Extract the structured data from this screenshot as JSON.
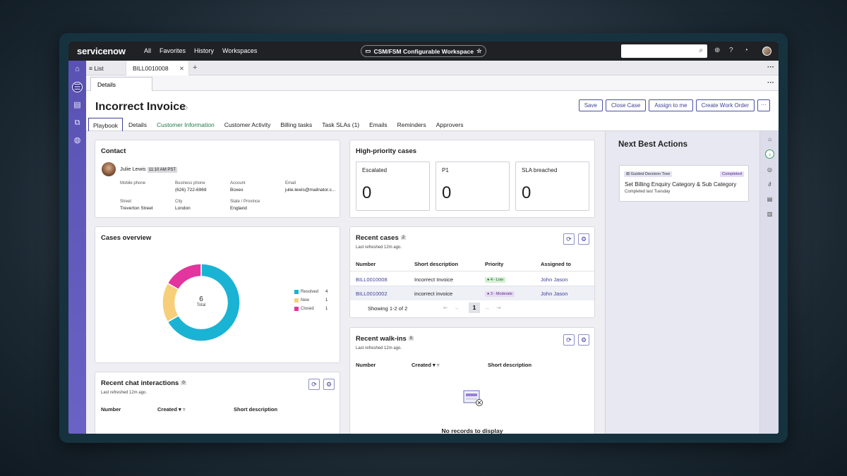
{
  "topbar": {
    "logo_main": "servicenow",
    "nav": [
      "All",
      "Favorites",
      "History",
      "Workspaces"
    ],
    "workspace_name": "CSM/FSM Configurable Workspace",
    "search_placeholder": ""
  },
  "tabs": {
    "list_label": "List",
    "open_tab": "BILL0010008",
    "subtab": "Details"
  },
  "record": {
    "title": "Incorrect Invoice",
    "actions": [
      "Save",
      "Close Case",
      "Assign to me",
      "Create Work Order"
    ],
    "tabs": [
      "Playbook",
      "Details",
      "Customer Information",
      "Customer Activity",
      "Billing tasks",
      "Task SLAs (1)",
      "Emails",
      "Reminders",
      "Approvers"
    ]
  },
  "contact": {
    "heading": "Contact",
    "name": "Julie Lewis",
    "local_time": "11:10 AM PST",
    "mobile_label": "Mobile phone",
    "mobile": "",
    "business_label": "Business phone",
    "business": "(626) 722-6969",
    "account_label": "Account",
    "account": "Boxeo",
    "email_label": "Email",
    "email": "julie.lewis@mailnator.c...",
    "street_label": "Street",
    "street": "Treverton Street",
    "city_label": "City",
    "city": "London",
    "state_label": "State / Province",
    "state": "England"
  },
  "high_priority": {
    "heading": "High-priority cases",
    "boxes": [
      {
        "label": "Escalated",
        "value": "0"
      },
      {
        "label": "P1",
        "value": "0"
      },
      {
        "label": "SLA breached",
        "value": "0"
      }
    ]
  },
  "cases_overview": {
    "heading": "Cases overview",
    "total_value": "6",
    "total_label": "Total"
  },
  "chart_data": {
    "type": "pie",
    "categories": [
      "Resolved",
      "New",
      "Closed"
    ],
    "values": [
      4,
      1,
      1
    ],
    "colors": [
      "#1ab3d4",
      "#f7cf7a",
      "#e2359e"
    ],
    "legend_placement": "right"
  },
  "recent_cases": {
    "heading": "Recent cases",
    "count": "2",
    "refreshed": "Last refreshed 12m ago.",
    "columns": [
      "Number",
      "Short description",
      "Priority",
      "Assigned to"
    ],
    "rows": [
      {
        "number": "BILL0010008",
        "desc": "Incorrect Invoice",
        "priority": "4 - Low",
        "assigned": "John Jason"
      },
      {
        "number": "BILL0010002",
        "desc": "incorrect invoice",
        "priority": "3 - Moderate",
        "assigned": "John Jason"
      }
    ],
    "showing": "Showing 1-2 of 2",
    "page": "1"
  },
  "recent_walkins": {
    "heading": "Recent walk-ins",
    "count": "0",
    "refreshed": "Last refreshed 12m ago.",
    "columns": [
      "Number",
      "Created",
      "Short description"
    ],
    "empty": "No records to display"
  },
  "recent_chats": {
    "heading": "Recent chat interactions",
    "count": "0",
    "refreshed": "Last refreshed 12m ago.",
    "columns": [
      "Number",
      "Created",
      "Short description"
    ]
  },
  "nba": {
    "heading": "Next Best Actions",
    "card_type": "Guided Decision Tree",
    "card_status": "Completed",
    "card_title": "Set Billing Enquiry Category & Sub Category",
    "card_sub": "Completed last Tuesday"
  }
}
